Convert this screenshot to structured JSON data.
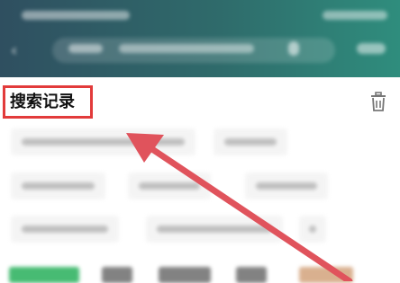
{
  "history": {
    "title": "搜索记录"
  },
  "icons": {
    "back": "chevron-left-icon",
    "trash": "trash-icon",
    "mic": "microphone-icon"
  },
  "colors": {
    "highlight": "#e23b3b",
    "arrow": "#e0535c",
    "active_tab": "#27b05b"
  }
}
